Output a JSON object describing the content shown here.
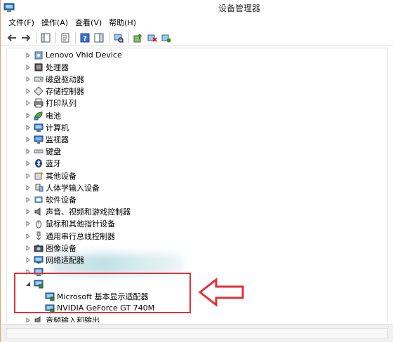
{
  "window": {
    "title": "设备管理器"
  },
  "menu": [
    "文件(F)",
    "操作(A)",
    "查看(V)",
    "帮助(H)"
  ],
  "toolbar": [
    {
      "name": "back-button",
      "icon": "arrow-left-icon"
    },
    {
      "name": "forward-button",
      "icon": "arrow-right-icon"
    },
    {
      "name": "show-hide-console-tree-button",
      "icon": "console-tree-icon"
    },
    {
      "name": "properties-button",
      "icon": "properties-icon"
    },
    {
      "name": "help-button",
      "icon": "help-icon"
    },
    {
      "name": "show-action-pane-button",
      "icon": "action-pane-icon"
    },
    {
      "name": "scan-hardware-button",
      "icon": "scan-icon"
    },
    {
      "name": "update-driver-button",
      "icon": "update-driver-icon"
    },
    {
      "name": "uninstall-button",
      "icon": "uninstall-icon"
    },
    {
      "name": "enable-device-button",
      "icon": "enable-device-icon"
    }
  ],
  "tree": [
    {
      "label": "Lenovo Vhid Device",
      "icon": "hid-device-icon",
      "level": 1,
      "expanded": false
    },
    {
      "label": "处理器",
      "icon": "processor-icon",
      "level": 1,
      "expanded": false
    },
    {
      "label": "磁盘驱动器",
      "icon": "disk-drive-icon",
      "level": 1,
      "expanded": false
    },
    {
      "label": "存储控制器",
      "icon": "storage-controller-icon",
      "level": 1,
      "expanded": false
    },
    {
      "label": "打印队列",
      "icon": "printer-icon",
      "level": 1,
      "expanded": false
    },
    {
      "label": "电池",
      "icon": "battery-icon",
      "level": 1,
      "expanded": false
    },
    {
      "label": "计算机",
      "icon": "computer-icon",
      "level": 1,
      "expanded": false
    },
    {
      "label": "监视器",
      "icon": "monitor-icon",
      "level": 1,
      "expanded": false
    },
    {
      "label": "键盘",
      "icon": "keyboard-icon",
      "level": 1,
      "expanded": false
    },
    {
      "label": "蓝牙",
      "icon": "bluetooth-icon",
      "level": 1,
      "expanded": false
    },
    {
      "label": "其他设备",
      "icon": "other-devices-icon",
      "level": 1,
      "expanded": false
    },
    {
      "label": "人体学输入设备",
      "icon": "hid-icon",
      "level": 1,
      "expanded": false
    },
    {
      "label": "软件设备",
      "icon": "software-device-icon",
      "level": 1,
      "expanded": false
    },
    {
      "label": "声音、视频和游戏控制器",
      "icon": "speaker-icon",
      "level": 1,
      "expanded": false
    },
    {
      "label": "鼠标和其他指针设备",
      "icon": "mouse-icon",
      "level": 1,
      "expanded": false
    },
    {
      "label": "通用串行总线控制器",
      "icon": "usb-icon",
      "level": 1,
      "expanded": false
    },
    {
      "label": "图像设备",
      "icon": "camera-icon",
      "level": 1,
      "expanded": false
    },
    {
      "label": "网络适配器",
      "icon": "network-adapter-icon",
      "level": 1,
      "expanded": false
    },
    {
      "label": "",
      "icon": "system-device-icon",
      "level": 1,
      "expanded": false
    },
    {
      "label": "",
      "icon": "display-adapter-icon",
      "level": 1,
      "expanded": true
    },
    {
      "label": "Microsoft 基本显示适配器",
      "icon": "display-adapter-icon",
      "level": 2
    },
    {
      "label": "NVIDIA GeForce GT 740M",
      "icon": "display-adapter-icon",
      "level": 2
    },
    {
      "label": "音频输入和输出",
      "icon": "audio-io-icon",
      "level": 1,
      "expanded": false
    }
  ],
  "colors": {
    "highlight": "#e0323a",
    "arrow": "#e0323a"
  }
}
